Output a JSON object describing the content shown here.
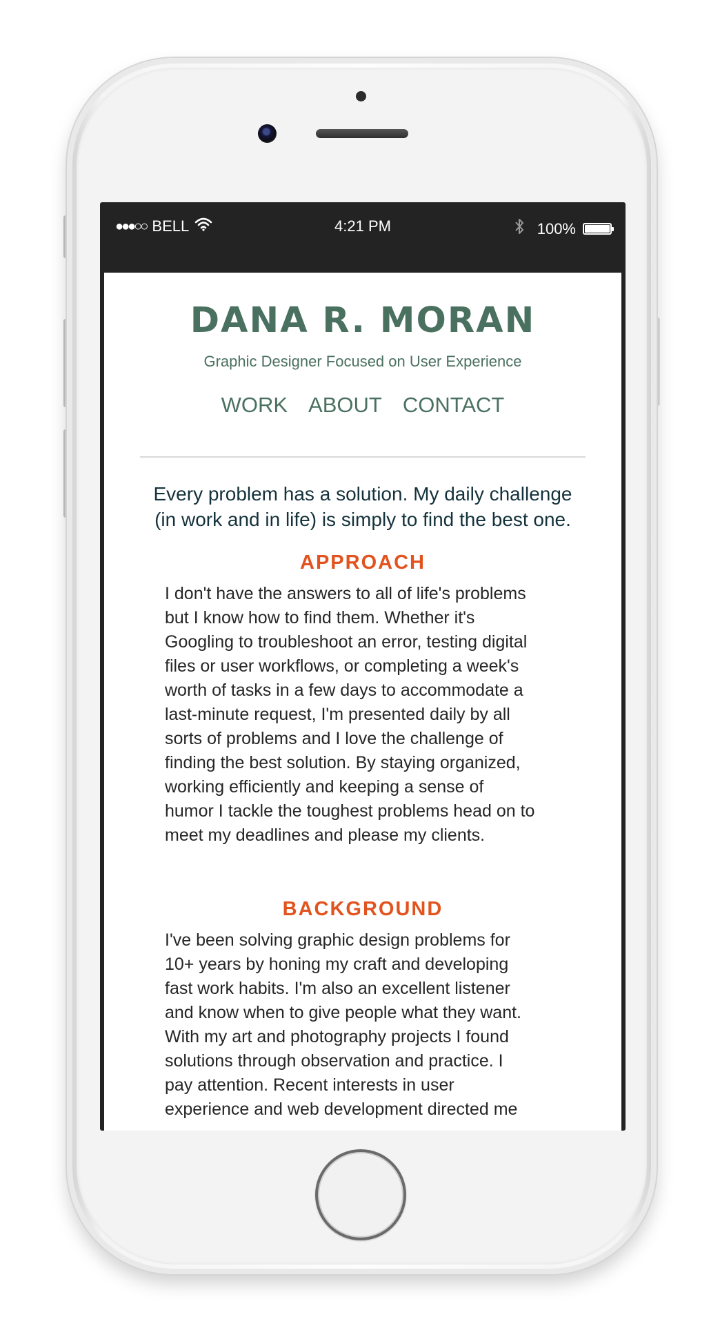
{
  "status_bar": {
    "signal": "●●●○○",
    "carrier": "BELL",
    "time": "4:21 PM",
    "battery": "100%",
    "icons": [
      "wifi-icon",
      "bluetooth-icon",
      "battery-icon"
    ]
  },
  "header": {
    "name": "DANA R. MORAN",
    "tagline": "Graphic Designer Focused on User Experience"
  },
  "nav": {
    "items": [
      "WORK",
      "ABOUT",
      "CONTACT"
    ]
  },
  "intro": "Every problem has a solution. My daily challenge\n(in work and in life) is simply to find the best one.",
  "sections": [
    {
      "title": "APPROACH",
      "body": "I don't have the answers to all of life's problems\nbut I know how to find them. Whether it's\nGoogling to troubleshoot an error, testing digital\nfiles or user workflows, or completing a week's\nworth of tasks in a few days to accommodate a\nlast-minute request, I'm presented daily by all\nsorts of problems and I love the challenge of\nfinding the best solution. By staying organized,\nworking efficiently and keeping a sense of\nhumor I tackle the toughest problems head on to\nmeet my deadlines and please my clients."
    },
    {
      "title": "BACKGROUND",
      "body": "I've been solving graphic design problems for\n10+ years by honing my craft and developing\nfast work habits. I'm also an excellent listener\nand know when to give people what they want.\nWith my art and photography projects I found\nsolutions through observation and practice. I\npay attention. Recent interests in user\nexperience and web development directed me"
    }
  ],
  "colors": {
    "brand_green": "#4a7060",
    "intro_navy": "#14323c",
    "section_orange": "#e2541f",
    "status_bar_bg": "#232323"
  }
}
